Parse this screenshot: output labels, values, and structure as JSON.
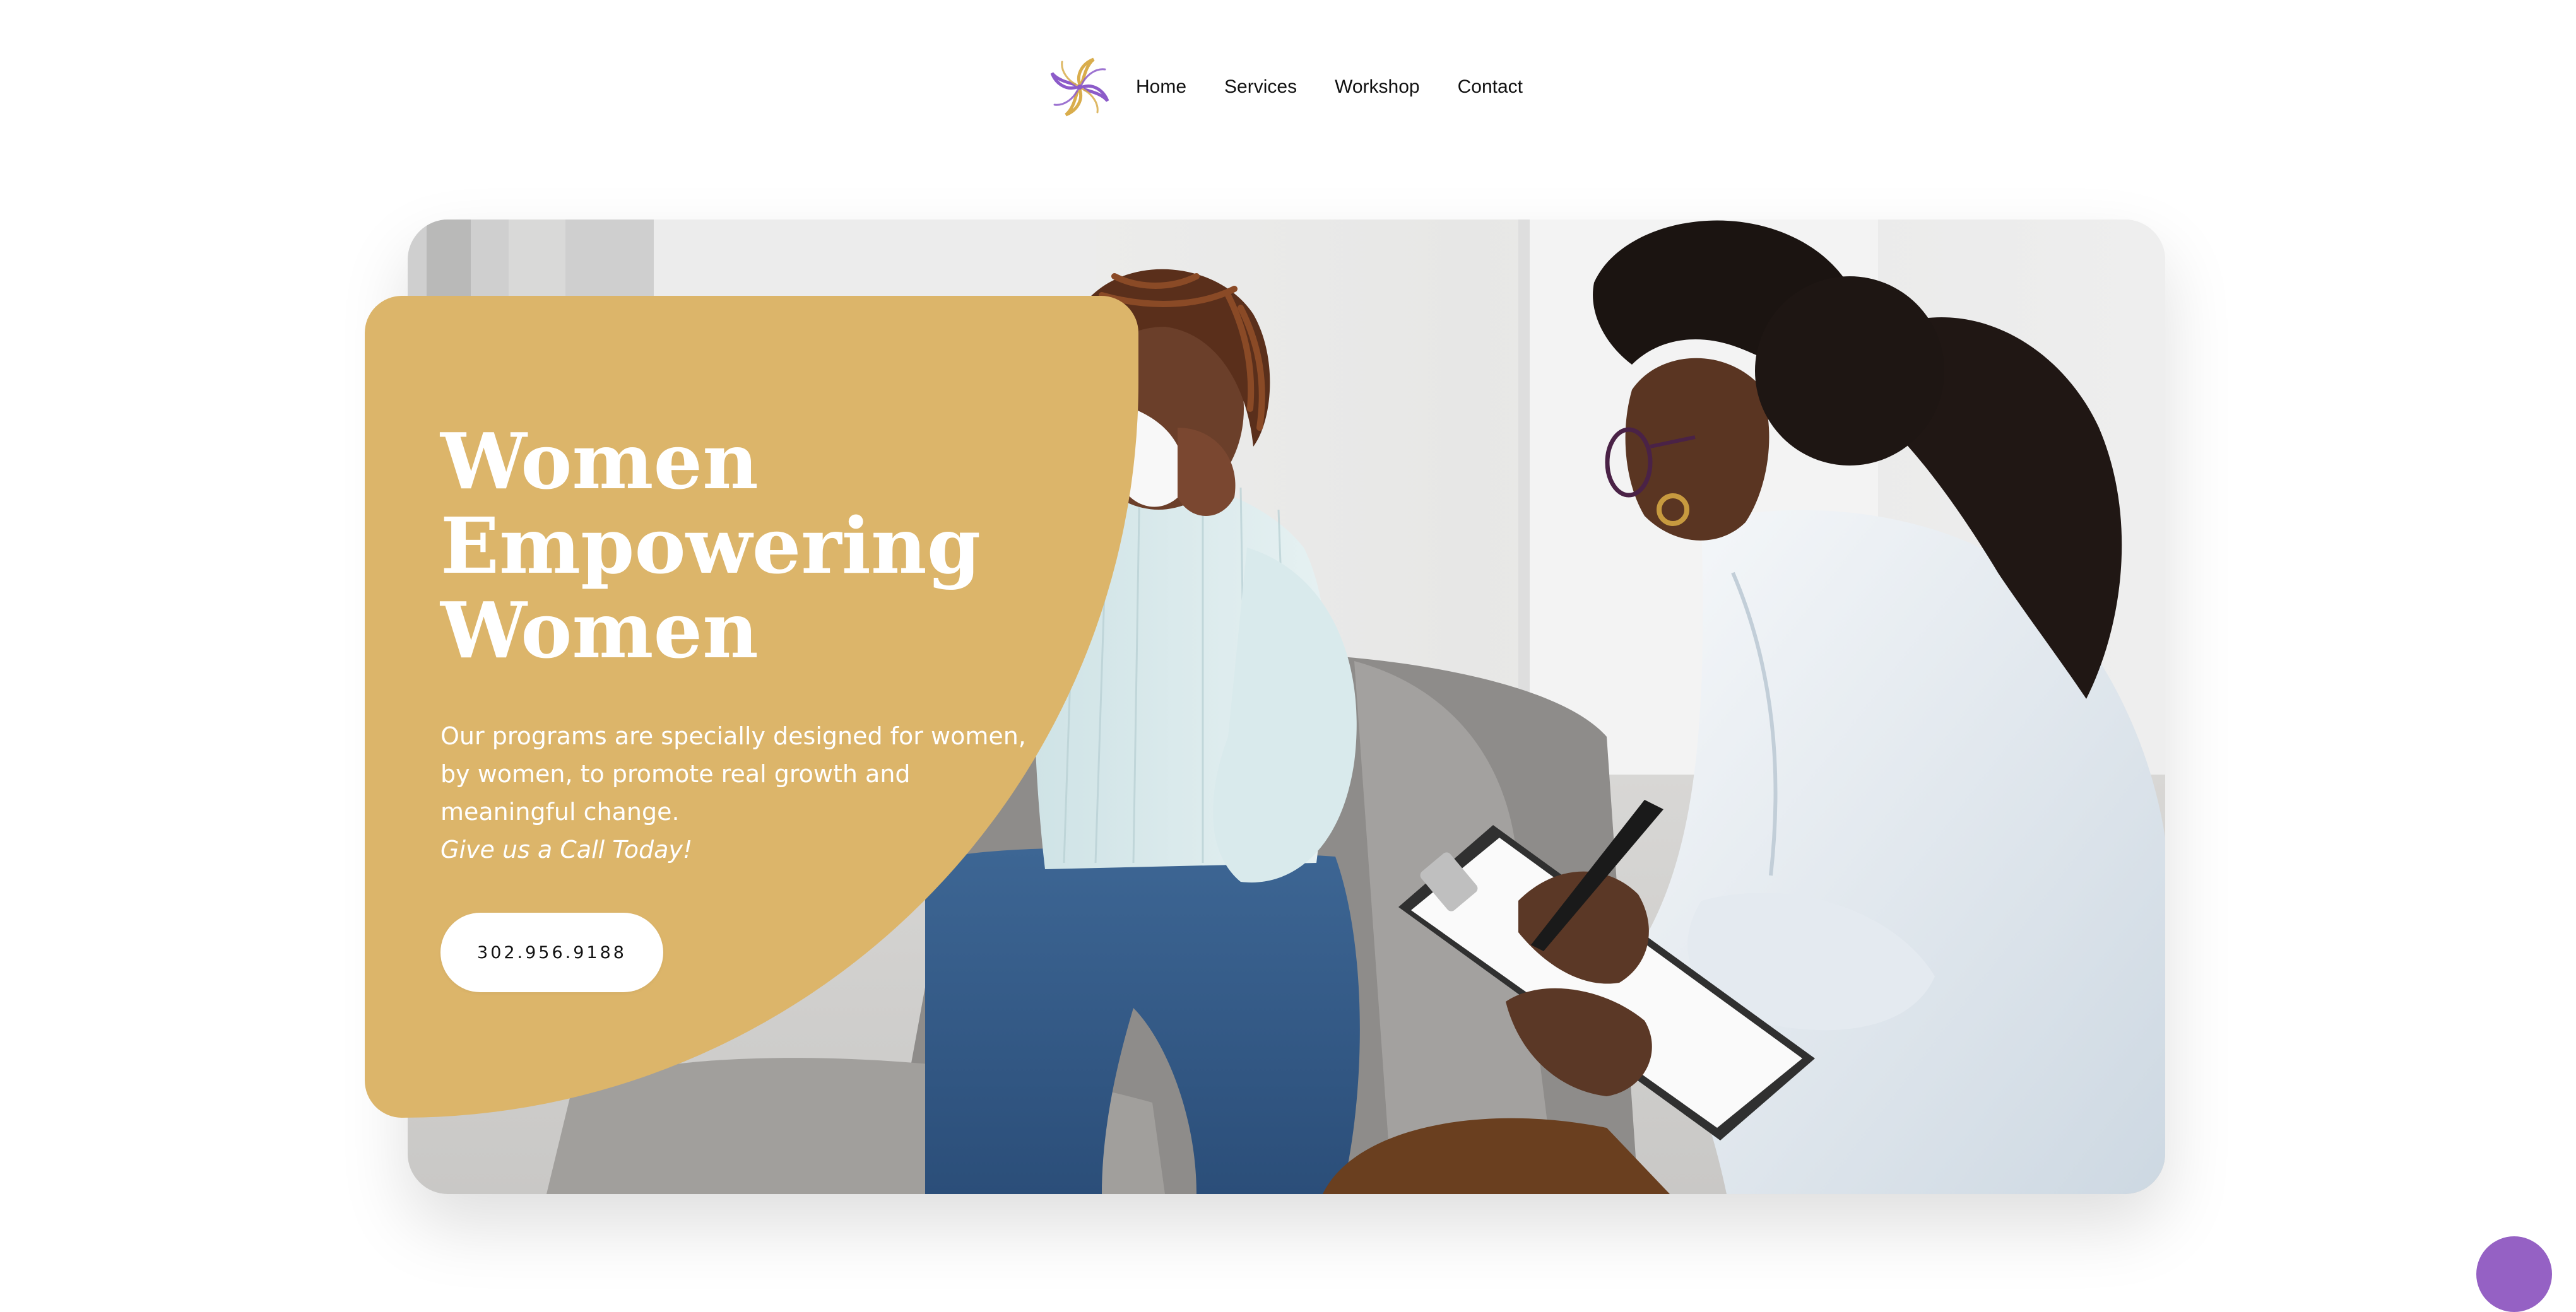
{
  "header": {
    "logo": {
      "icon": "pinwheel-flower-logo-icon",
      "colors": [
        "#8c5bc9",
        "#d9ad4c"
      ]
    },
    "nav": [
      {
        "label": "Home"
      },
      {
        "label": "Services"
      },
      {
        "label": "Workshop"
      },
      {
        "label": "Contact"
      }
    ]
  },
  "hero": {
    "title_lines": [
      "Women",
      "Empowering",
      "Women"
    ],
    "description": "Our programs are specially designed for women, by women, to promote real growth and meaningful change.",
    "call_note": "Give us a Call Today!",
    "phone_button_label": "302.956.9188",
    "photo": "counseling-session-photo",
    "card_color": "#dcb56a"
  },
  "chat_widget": {
    "icon": "chat-bubble-icon",
    "color": "#9561c4"
  }
}
